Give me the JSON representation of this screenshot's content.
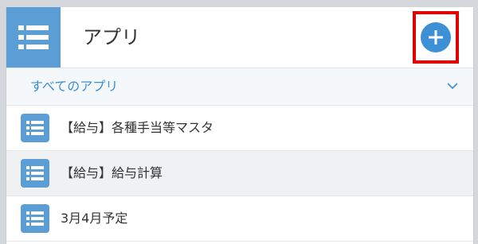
{
  "header": {
    "logo_icon": "app-list-icon",
    "title": "アプリ",
    "add_button_icon": "plus-icon"
  },
  "filter": {
    "label": "すべてのアプリ",
    "dropdown_icon": "chevron-down-icon"
  },
  "apps": [
    {
      "label": "【給与】各種手当等マスタ",
      "icon": "app-list-icon"
    },
    {
      "label": "【給与】給与計算",
      "icon": "app-list-icon"
    },
    {
      "label": "3月4月予定",
      "icon": "app-list-icon"
    }
  ],
  "colors": {
    "accent": "#3d8fd6",
    "icon_bg": "#5b9ed6",
    "highlight_box": "#e00000",
    "row_alt": "#eff1f2"
  }
}
